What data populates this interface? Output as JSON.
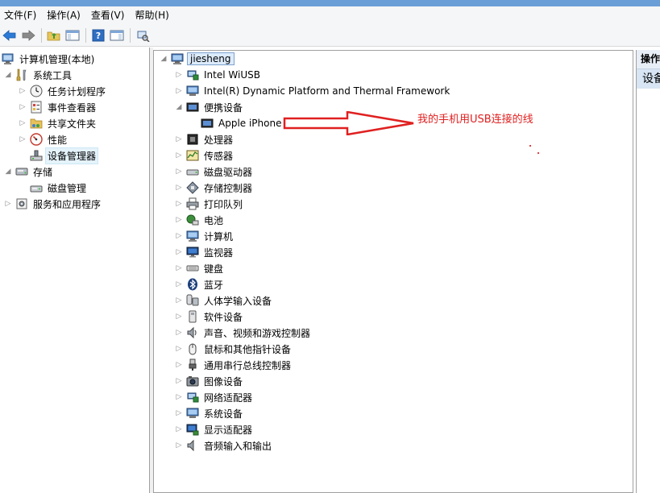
{
  "menu": [
    "文件(F)",
    "操作(A)",
    "查看(V)",
    "帮助(H)"
  ],
  "toolbar_icons": [
    "back-arrow-icon",
    "forward-arrow-icon",
    "up-folder-icon",
    "show-hide-tree-icon",
    "help-icon",
    "action-pane-icon",
    "scan-hardware-icon"
  ],
  "left_tree": {
    "root": "计算机管理(本地)",
    "system_tools": "系统工具",
    "task_scheduler": "任务计划程序",
    "event_viewer": "事件查看器",
    "shared_folders": "共享文件夹",
    "performance": "性能",
    "device_manager": "设备管理器",
    "storage": "存储",
    "disk_management": "磁盘管理",
    "services_apps": "服务和应用程序"
  },
  "device_tree": {
    "root": "jiesheng",
    "intel_wiusb": "Intel WiUSB",
    "intel_dptf": "Intel(R) Dynamic Platform and Thermal Framework",
    "portable": "便携设备",
    "apple_iphone": "Apple iPhone",
    "processor": "处理器",
    "sensors": "传感器",
    "disk_drives": "磁盘驱动器",
    "storage_controllers": "存储控制器",
    "print_queues": "打印队列",
    "battery": "电池",
    "computer": "计算机",
    "monitors": "监视器",
    "keyboard": "键盘",
    "bluetooth": "蓝牙",
    "hid": "人体学输入设备",
    "software_devices": "软件设备",
    "sound": "声音、视频和游戏控制器",
    "mice": "鼠标和其他指针设备",
    "usb": "通用串行总线控制器",
    "imaging": "图像设备",
    "network": "网络适配器",
    "system_devices": "系统设备",
    "display": "显示适配器",
    "audio_io": "音频输入和输出"
  },
  "actions": {
    "header": "操作",
    "item": "设备管理器"
  },
  "annotation": "我的手机用USB连接的线",
  "colors": {
    "annotation": "#e02020",
    "selection": "#e5f3fb",
    "title_bar": "#6a9ed6"
  }
}
